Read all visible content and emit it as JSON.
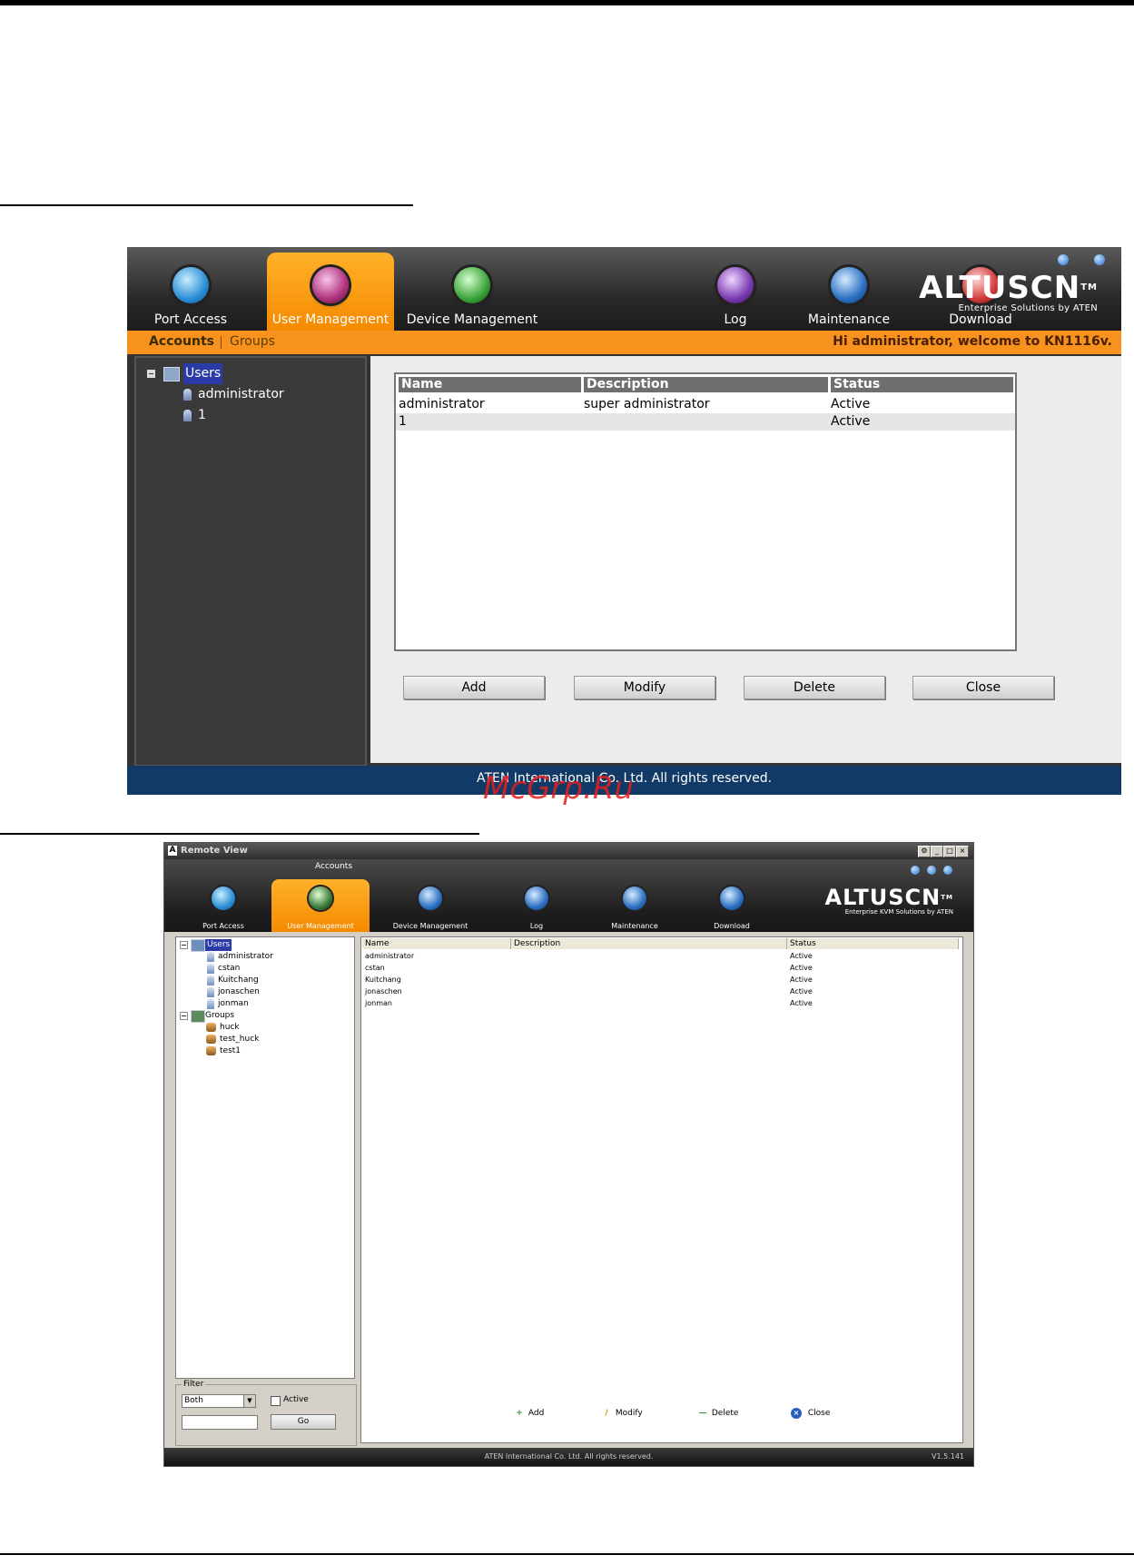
{
  "screen1": {
    "tabs": [
      {
        "label": "Port Access",
        "icon": "port-access-icon"
      },
      {
        "label": "User Management",
        "icon": "user-management-icon"
      },
      {
        "label": "Device Management",
        "icon": "device-management-icon"
      },
      {
        "label": "Log",
        "icon": "log-icon"
      },
      {
        "label": "Maintenance",
        "icon": "maintenance-icon"
      },
      {
        "label": "Download",
        "icon": "download-icon"
      }
    ],
    "active_tab": "User Management",
    "brand": {
      "logo": "ALTUSCN",
      "tm": "TM",
      "tagline": "Enterprise Solutions by ATEN"
    },
    "subnav": {
      "accounts": "Accounts",
      "groups": "Groups"
    },
    "welcome": "Hi administrator, welcome to KN1116v.",
    "tree": {
      "root": "Users",
      "items": [
        "administrator",
        "1"
      ]
    },
    "table": {
      "columns": [
        "Name",
        "Description",
        "Status"
      ],
      "rows": [
        [
          "administrator",
          "super administrator",
          "Active"
        ],
        [
          "1",
          "",
          "Active"
        ]
      ]
    },
    "buttons": {
      "add": "Add",
      "modify": "Modify",
      "delete": "Delete",
      "close": "Close"
    },
    "footer": "ATEN International Co. Ltd. All rights reserved.",
    "colors": {
      "accent": "#f7921e",
      "footer": "#123a66",
      "selection": "#2a3aa6"
    }
  },
  "watermark": "McGrp.Ru",
  "screen2": {
    "window_title": "Remote View",
    "section": "Accounts",
    "tabs": [
      {
        "label": "Port Access",
        "icon": "port-access-icon"
      },
      {
        "label": "User Management",
        "icon": "user-management-icon"
      },
      {
        "label": "Device Management",
        "icon": "device-management-icon"
      },
      {
        "label": "Log",
        "icon": "log-icon"
      },
      {
        "label": "Maintenance",
        "icon": "maintenance-icon"
      },
      {
        "label": "Download",
        "icon": "download-icon"
      }
    ],
    "brand": {
      "logo": "ALTUSCN",
      "tm": "TM",
      "tagline": "Enterprise KVM Solutions by ATEN"
    },
    "tree": {
      "users_label": "Users",
      "users": [
        "administrator",
        "cstan",
        "Kuitchang",
        "jonaschen",
        "jonman"
      ],
      "groups_label": "Groups",
      "groups": [
        "huck",
        "test_huck",
        "test1"
      ]
    },
    "filter": {
      "legend": "Filter",
      "select_value": "Both",
      "active_label": "Active",
      "go_label": "Go"
    },
    "table": {
      "columns": [
        "Name",
        "Description",
        "Status"
      ],
      "rows": [
        [
          "administrator",
          "",
          "Active"
        ],
        [
          "cstan",
          "",
          "Active"
        ],
        [
          "Kuitchang",
          "",
          "Active"
        ],
        [
          "jonaschen",
          "",
          "Active"
        ],
        [
          "jonman",
          "",
          "Active"
        ]
      ]
    },
    "actions": {
      "add": "Add",
      "modify": "Modify",
      "delete": "Delete",
      "close": "Close"
    },
    "footer": "ATEN International Co. Ltd. All rights reserved.",
    "version": "V1.5.141"
  }
}
